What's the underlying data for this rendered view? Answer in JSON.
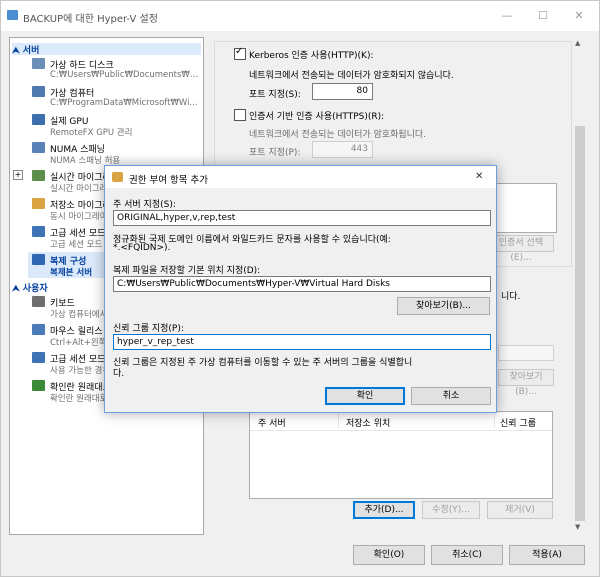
{
  "window": {
    "title": "BACKUP에 대한 Hyper-V 설정",
    "minimize": "—",
    "maximize": "☐",
    "close": "✕"
  },
  "tree": {
    "server_header": "서버",
    "user_header": "사용자",
    "items": [
      {
        "label": "가상 하드 디스크",
        "sub": "C:₩Users₩Public₩Documents₩Hy..."
      },
      {
        "label": "가상 컴퓨터",
        "sub": "C:₩ProgramData₩Microsoft₩Wi..."
      },
      {
        "label": "실제 GPU",
        "sub": "RemoteFX GPU 관리"
      },
      {
        "label": "NUMA 스패닝",
        "sub": "NUMA 스패닝 허용"
      },
      {
        "label": "실시간 마이그레이션",
        "sub": "실시간 마이그레이션"
      },
      {
        "label": "저장소 마이그레이션",
        "sub": "동시 마이그레이션"
      },
      {
        "label": "고급 세션 모드 정책",
        "sub": "고급 세션 모드"
      },
      {
        "label": "복제 구성",
        "sub": "복제본 서버"
      }
    ],
    "user_items": [
      {
        "label": "키보드",
        "sub": "가상 컴퓨터에서 사용"
      },
      {
        "label": "마우스 릴리스 키",
        "sub": "Ctrl+Alt+왼쪽 화살표"
      },
      {
        "label": "고급 세션 모드",
        "sub": "사용 가능한 경우 사용"
      },
      {
        "label": "확인란 원래대로",
        "sub": "확인란 원래대로"
      }
    ]
  },
  "right": {
    "kerberos_label": "Kerberos 인증 사용(HTTP)(K):",
    "kerberos_desc": "네트워크에서 전송되는 데이터가 암호화되지 않습니다.",
    "port_label1": "포트 지정(S):",
    "port_value1": "80",
    "cert_label": "인증서 기반 인증 사용(HTTPS)(R):",
    "cert_desc": "네트워크에서 전송되는 데이터가 암호화됩니다.",
    "port_label2": "포트 지정(P):",
    "port_value2": "443",
    "select_cert_button": "인증서 선택(E)...",
    "partial_text": "니다.",
    "browse2_button": "찾아보기(B)...",
    "table_headers": [
      "주 서버",
      "저장소 위치",
      "신뢰 그룹"
    ],
    "add_button": "추가(D)...",
    "edit_button": "수정(Y)...",
    "remove_button": "제거(V)"
  },
  "footer": {
    "ok": "확인(O)",
    "cancel": "취소(C)",
    "apply": "적용(A)"
  },
  "dialog": {
    "title": "권한 부여 항목 추가",
    "primary_label": "주 서버 지정(S):",
    "primary_value": "ORIGINAL,hyper,v,rep,test",
    "primary_hint1": "정규화된 국제 도메인 이름에서 와일드카드 문자를 사용할 수 있습니다(예:",
    "primary_hint2": "*.<FQIDN>).",
    "location_label": "복제 파일을 저장할 기본 위치 지정(D):",
    "location_value": "C:₩Users₩Public₩Documents₩Hyper-V₩Virtual Hard Disks",
    "browse_button": "찾아보기(B)...",
    "trust_label": "신뢰 그룹 지정(P):",
    "trust_value": "hyper_v_rep_test",
    "trust_hint1": "신뢰 그룹은 지정된 주 가상 컴퓨터를 이동할 수 있는 주 서버의 그룹을 식별합니",
    "trust_hint2": "다.",
    "ok": "확인",
    "cancel": "취소",
    "close": "✕"
  },
  "colors": {
    "accent": "#0078d7",
    "category_text": "#003f9d",
    "selection": "#dbe9fb"
  }
}
